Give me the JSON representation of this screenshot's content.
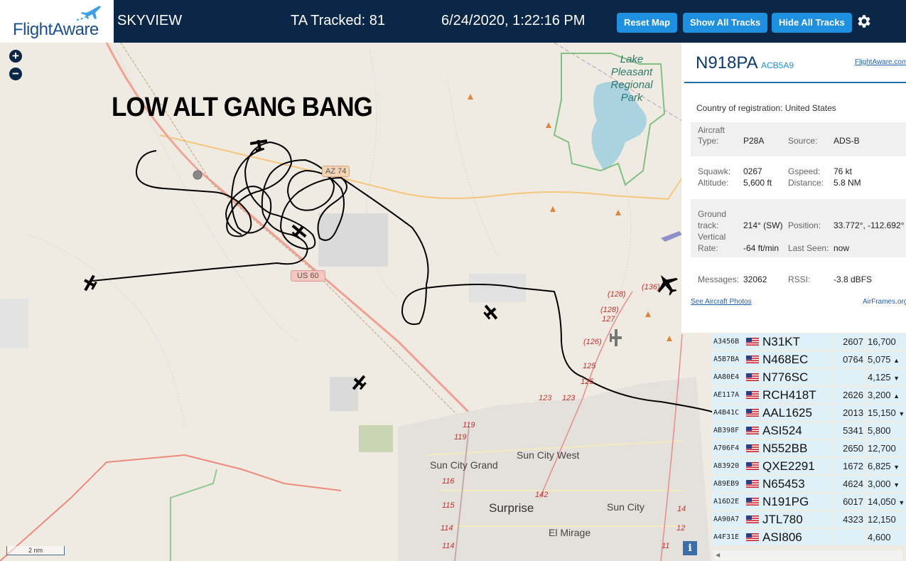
{
  "header": {
    "logo_text": "FlightAware",
    "app_name": "SKYVIEW",
    "tracked": "TA Tracked: 81",
    "timestamp": "6/24/2020, 1:22:16 PM",
    "buttons": {
      "reset": "Reset Map",
      "show_all": "Show All Tracks",
      "hide_all": "Hide All Tracks"
    },
    "settings_icon": "gear-icon"
  },
  "map": {
    "annotation": "LOW ALT GANG BANG",
    "zoom_in": "+",
    "zoom_out": "−",
    "scale": "2 nm",
    "info_button": "i",
    "labels": {
      "lake": [
        "Lake Pleasant",
        "Regional",
        "Park"
      ],
      "az74": "AZ 74",
      "us60": "US 60",
      "sun_city_west": "Sun City West",
      "sun_city_grand": "Sun City Grand",
      "surprise": "Surprise",
      "sun_city": "Sun City",
      "el_mirage": "El Mirage",
      "routes": [
        "(136)",
        "(128)",
        "(128)",
        "127",
        "(126)",
        "125",
        "125",
        "123",
        "123",
        "119",
        "119",
        "116",
        "115",
        "114",
        "114",
        "142",
        "14",
        "12",
        "11"
      ]
    }
  },
  "aircraft_panel": {
    "registration": "N918PA",
    "hex": "ACB5A9",
    "link": "FlightAware.com",
    "country": "Country of registration: United States",
    "type_label": "Aircraft Type:",
    "type_label_1": "Aircraft",
    "type_label_2": "Type:",
    "type": "P28A",
    "source_label": "Source:",
    "source": "ADS-B",
    "squawk_label": "Squawk:",
    "squawk": "0267",
    "gspeed_label": "Gspeed:",
    "gspeed": "76 kt",
    "altitude_label": "Altitude:",
    "altitude": "5,600 ft",
    "distance_label": "Distance:",
    "distance": "5.8 NM",
    "track_label_1": "Ground",
    "track_label_2": "track:",
    "track": "214° (SW)",
    "position_label": "Position:",
    "position": "33.772°, -112.692°",
    "vrate_label_1": "Vertical",
    "vrate_label_2": "Rate:",
    "vrate": "-64 ft/min",
    "last_seen_label": "Last Seen:",
    "last_seen": "now",
    "messages_label": "Messages:",
    "messages": "32062",
    "rssi_label": "RSSI:",
    "rssi": "-3.8 dBFS",
    "photos_link": "See Aircraft Photos",
    "airframes_link": "AirFrames.org"
  },
  "tracks": [
    {
      "hex": "A3456B",
      "callsign": "N31KT",
      "squawk": "2607",
      "altitude": "16,700",
      "trend": ""
    },
    {
      "hex": "A5B7BA",
      "callsign": "N468EC",
      "squawk": "0764",
      "altitude": "5,075",
      "trend": "▲"
    },
    {
      "hex": "AA80E4",
      "callsign": "N776SC",
      "squawk": "",
      "altitude": "4,125",
      "trend": "▼"
    },
    {
      "hex": "AE117A",
      "callsign": "RCH418T",
      "squawk": "2626",
      "altitude": "3,200",
      "trend": "▲"
    },
    {
      "hex": "A4B41C",
      "callsign": "AAL1625",
      "squawk": "2013",
      "altitude": "15,150",
      "trend": "▼"
    },
    {
      "hex": "AB398F",
      "callsign": "ASI524",
      "squawk": "5341",
      "altitude": "5,800",
      "trend": ""
    },
    {
      "hex": "A706F4",
      "callsign": "N552BB",
      "squawk": "2650",
      "altitude": "12,700",
      "trend": ""
    },
    {
      "hex": "A83920",
      "callsign": "QXE2291",
      "squawk": "1672",
      "altitude": "6,825",
      "trend": "▼"
    },
    {
      "hex": "A89EB9",
      "callsign": "N65453",
      "squawk": "4624",
      "altitude": "3,000",
      "trend": "▼"
    },
    {
      "hex": "A16D2E",
      "callsign": "N191PG",
      "squawk": "6017",
      "altitude": "14,050",
      "trend": "▼"
    },
    {
      "hex": "AA90A7",
      "callsign": "JTL780",
      "squawk": "4323",
      "altitude": "12,150",
      "trend": ""
    },
    {
      "hex": "A4F31E",
      "callsign": "ASI806",
      "squawk": "",
      "altitude": "4,600",
      "trend": ""
    }
  ],
  "colors": {
    "header_bg": "#0b2747",
    "button": "#1f8fe0",
    "row_bg": "#dff0f8",
    "map_bg": "#efebe3"
  }
}
